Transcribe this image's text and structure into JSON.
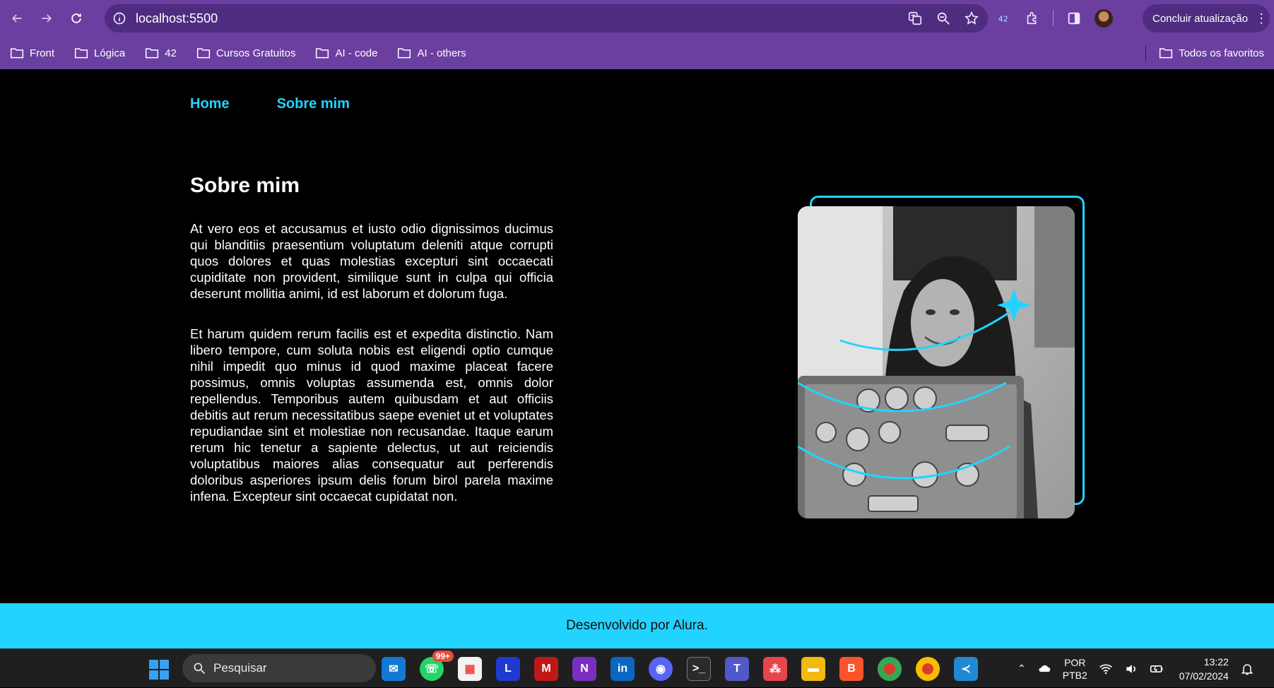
{
  "browser": {
    "url": "localhost:5500",
    "update_button": "Concluir atualização",
    "bookmarks": [
      "Front",
      "Lógica",
      "42",
      "Cursos Gratuitos",
      "AI - code",
      "AI - others"
    ],
    "all_bookmarks": "Todos os favoritos"
  },
  "site": {
    "nav": [
      "Home",
      "Sobre mim"
    ],
    "title": "Sobre mim",
    "paragraphs": [
      "At vero eos et accusamus et iusto odio dignissimos ducimus qui blanditiis praesentium voluptatum deleniti atque corrupti quos dolores et quas molestias excepturi sint occaecati cupiditate non provident, similique sunt in culpa qui officia deserunt mollitia animi, id est laborum et dolorum fuga.",
      "Et harum quidem rerum facilis est et expedita distinctio. Nam libero tempore, cum soluta nobis est eligendi optio cumque nihil impedit quo minus id quod maxime placeat facere possimus, omnis voluptas assumenda est, omnis dolor repellendus. Temporibus autem quibusdam et aut officiis debitis aut rerum necessitatibus saepe eveniet ut et voluptates repudiandae sint et molestiae non recusandae. Itaque earum rerum hic tenetur a sapiente delectus, ut aut reiciendis voluptatibus maiores alias consequatur aut perferendis doloribus asperiores ipsum delis forum birol parela maxime infena. Excepteur sint occaecat cupidatat non."
    ],
    "footer": "Desenvolvido por Alura.",
    "accent_color": "#23d3ff",
    "brand_color": "#6a3fa0"
  },
  "taskbar": {
    "search_placeholder": "Pesquisar",
    "whatsapp_badge": "99+",
    "lang_line1": "POR",
    "lang_line2": "PTB2",
    "time": "13:22",
    "date": "07/02/2024"
  }
}
